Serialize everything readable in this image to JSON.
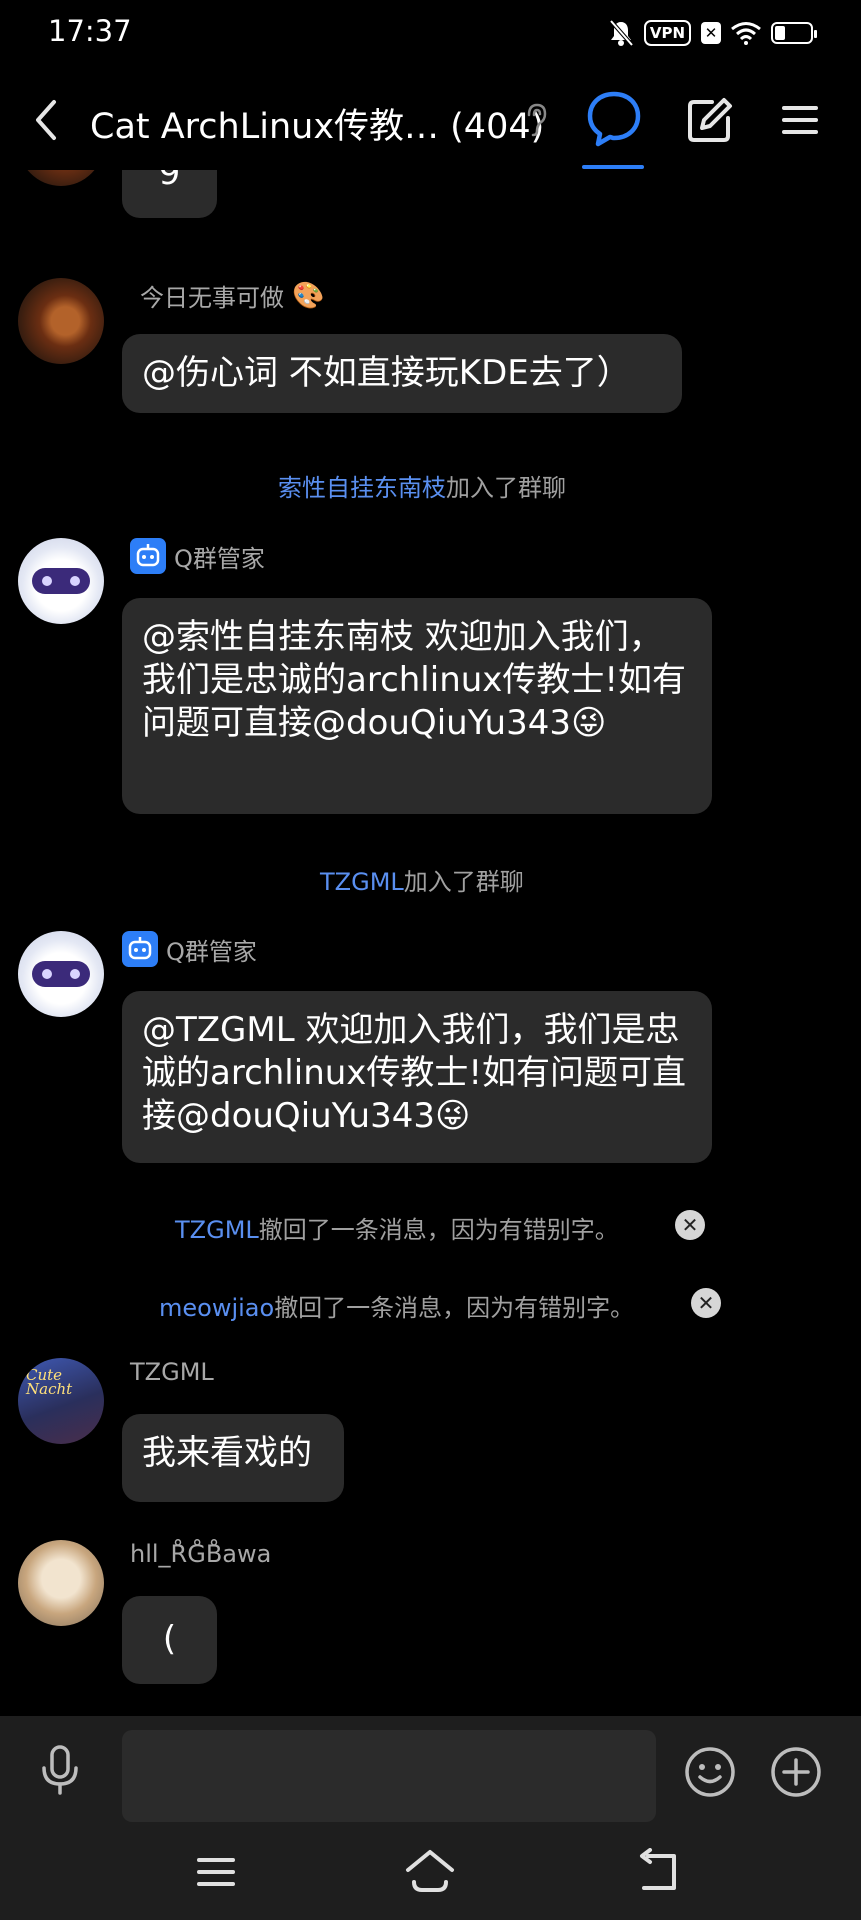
{
  "status_bar": {
    "time": "17:37",
    "vpn": "VPN",
    "x_badge": "✕"
  },
  "header": {
    "title": "Cat ArchLinux传教… (404)"
  },
  "messages": {
    "top_partial": {
      "text": "9"
    },
    "msg1": {
      "sender": "今日无事可做",
      "sender_decor": "🎨",
      "text": "@伤心词 不如直接玩KDE去了）"
    },
    "join1": {
      "user": "索性自挂东南枝",
      "text": "加入了群聊"
    },
    "msg2": {
      "sender": "Q群管家",
      "text": "@索性自挂东南枝 欢迎加入我们，我们是忠诚的archlinux传教士!如有问题可直接@douQiuYu343😜"
    },
    "join2": {
      "user": "TZGML",
      "text": "加入了群聊"
    },
    "msg3": {
      "sender": "Q群管家",
      "text": "@TZGML 欢迎加入我们，我们是忠诚的archlinux传教士!如有问题可直接@douQiuYu343😜"
    },
    "recall1": {
      "user": "TZGML",
      "text": "撤回了一条消息，因为有错别字。"
    },
    "recall2": {
      "user": "meowjiao",
      "text": "撤回了一条消息，因为有错别字。"
    },
    "msg4": {
      "sender": "TZGML",
      "text": "我来看戏的",
      "avatar_text": "Cute Nacht"
    },
    "msg5": {
      "sender": "hll_R̊G̊B̊awa",
      "text": "("
    }
  },
  "input": {
    "placeholder": ""
  },
  "colors": {
    "accent": "#2d7ef7",
    "link": "#5a8ff0",
    "bubble": "#2b2b2b",
    "background": "#000000"
  }
}
